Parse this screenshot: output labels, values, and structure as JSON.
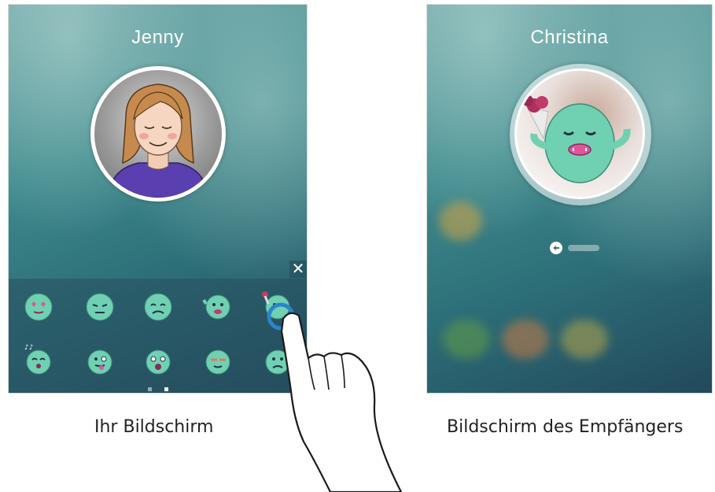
{
  "left_screen": {
    "contact_name": "Jenny",
    "caption": "Ihr Bildschirm",
    "close_icon": "close-icon",
    "sticker_rows": [
      [
        "heart-eyes",
        "annoyed",
        "crying",
        "waving",
        "flowers"
      ],
      [
        "singing",
        "tongue-out",
        "surprised",
        "blushing",
        "sad"
      ]
    ],
    "page_count": 2,
    "active_page": 2
  },
  "right_screen": {
    "contact_name": "Christina",
    "caption": "Bildschirm des Empfängers"
  },
  "colors": {
    "screen_top": "#6fa7a8",
    "screen_bottom": "#22495c",
    "sticker_body": "#6fd1b2",
    "touch_highlight": "#2a86c8"
  }
}
